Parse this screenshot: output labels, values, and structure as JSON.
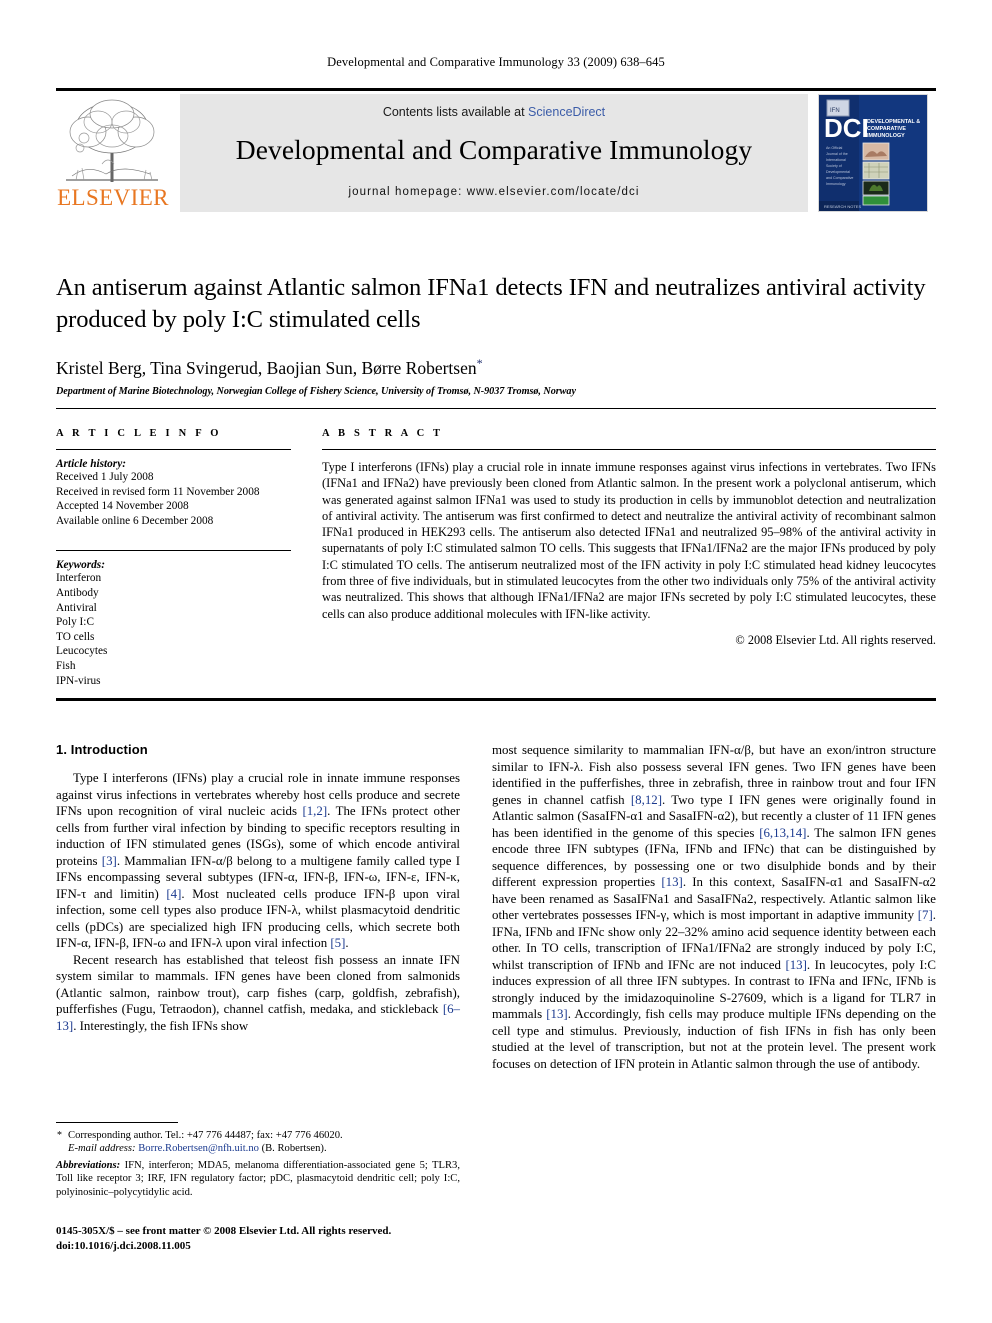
{
  "running_head": "Developmental and Comparative Immunology 33 (2009) 638–645",
  "masthead": {
    "contents_prefix": "Contents lists available at ",
    "sciencedirect": "ScienceDirect",
    "journal_name": "Developmental and Comparative Immunology",
    "homepage": "journal homepage: www.elsevier.com/locate/dci",
    "elsevier_wordmark": "ELSEVIER",
    "cover_brand": "DCI",
    "cover_title_line1": "DEVELOPMENTAL &",
    "cover_title_line2": "COMPARATIVE",
    "cover_title_line3": "IMMUNOLOGY",
    "link_color": "#3b5ca8",
    "elsevier_orange": "#E87722",
    "cover_blue": "#0d2f73"
  },
  "title": "An antiserum against Atlantic salmon IFNa1 detects IFN and neutralizes antiviral activity produced by poly I:C stimulated cells",
  "authors": "Kristel Berg, Tina Svingerud, Baojian Sun, Børre Robertsen",
  "author_star": "*",
  "affiliation": "Department of Marine Biotechnology, Norwegian College of Fishery Science, University of Tromsø, N-9037 Tromsø, Norway",
  "article_info": {
    "heading": "A R T I C L E   I N F O",
    "history_label": "Article history:",
    "history": [
      "Received 1 July 2008",
      "Received in revised form 11 November 2008",
      "Accepted 14 November 2008",
      "Available online 6 December 2008"
    ],
    "keywords_label": "Keywords:",
    "keywords": [
      "Interferon",
      "Antibody",
      "Antiviral",
      "Poly I:C",
      "TO cells",
      "Leucocytes",
      "Fish",
      "IPN-virus"
    ]
  },
  "abstract": {
    "heading": "A B S T R A C T",
    "text": "Type I interferons (IFNs) play a crucial role in innate immune responses against virus infections in vertebrates. Two IFNs (IFNa1 and IFNa2) have previously been cloned from Atlantic salmon. In the present work a polyclonal antiserum, which was generated against salmon IFNa1 was used to study its production in cells by immunoblot detection and neutralization of antiviral activity. The antiserum was first confirmed to detect and neutralize the antiviral activity of recombinant salmon IFNa1 produced in HEK293 cells. The antiserum also detected IFNa1 and neutralized 95–98% of the antiviral activity in supernatants of poly I:C stimulated salmon TO cells. This suggests that IFNa1/IFNa2 are the major IFNs produced by poly I:C stimulated TO cells. The antiserum neutralized most of the IFN activity in poly I:C stimulated head kidney leucocytes from three of five individuals, but in stimulated leucocytes from the other two individuals only 75% of the antiviral activity was neutralized. This shows that although IFNa1/IFNa2 are major IFNs secreted by poly I:C stimulated leucocytes, these cells can also produce additional molecules with IFN-like activity.",
    "copyright": "© 2008 Elsevier Ltd. All rights reserved."
  },
  "introduction": {
    "heading": "1. Introduction",
    "left_paragraphs": [
      "Type I interferons (IFNs) play a crucial role in innate immune responses against virus infections in vertebrates whereby host cells produce and secrete IFNs upon recognition of viral nucleic acids [1,2]. The IFNs protect other cells from further viral infection by binding to specific receptors resulting in induction of IFN stimulated genes (ISGs), some of which encode antiviral proteins [3]. Mammalian IFN-α/β belong to a multigene family called type I IFNs encompassing several subtypes (IFN-α, IFN-β, IFN-ω, IFN-ε, IFN-κ, IFN-τ and limitin) [4]. Most nucleated cells produce IFN-β upon viral infection, some cell types also produce IFN-λ, whilst plasmacytoid dendritic cells (pDCs) are specialized high IFN producing cells, which secrete both IFN-α, IFN-β, IFN-ω and IFN-λ upon viral infection [5].",
      "Recent research has established that teleost fish possess an innate IFN system similar to mammals. IFN genes have been cloned from salmonids (Atlantic salmon, rainbow trout), carp fishes (carp, goldfish, zebrafish), pufferfishes (Fugu, Tetraodon), channel catfish, medaka, and stickleback [6–13]. Interestingly, the fish IFNs show"
    ],
    "right_paragraphs": [
      "most sequence similarity to mammalian IFN-α/β, but have an exon/intron structure similar to IFN-λ. Fish also possess several IFN genes. Two IFN genes have been identified in the pufferfishes, three in zebrafish, three in rainbow trout and four IFN genes in channel catfish [8,12]. Two type I IFN genes were originally found in Atlantic salmon (SasaIFN-α1 and SasaIFN-α2), but recently a cluster of 11 IFN genes has been identified in the genome of this species [6,13,14]. The salmon IFN genes encode three IFN subtypes (IFNa, IFNb and IFNc) that can be distinguished by sequence differences, by possessing one or two disulphide bonds and by their different expression properties [13]. In this context, SasaIFN-α1 and SasaIFN-α2 have been renamed as SasaIFNa1 and SasaIFNa2, respectively. Atlantic salmon like other vertebrates possesses IFN-γ, which is most important in adaptive immunity [7]. IFNa, IFNb and IFNc show only 22–32% amino acid sequence identity between each other. In TO cells, transcription of IFNa1/IFNa2 are strongly induced by poly I:C, whilst transcription of IFNb and IFNc are not induced [13]. In leucocytes, poly I:C induces expression of all three IFN subtypes. In contrast to IFNa and IFNc, IFNb is strongly induced by the imidazoquinoline S-27609, which is a ligand for TLR7 in mammals [13]. Accordingly, fish cells may produce multiple IFNs depending on the cell type and stimulus. Previously, induction of fish IFNs in fish has only been studied at the level of transcription, but not at the protein level. The present work focuses on detection of IFN protein in Atlantic salmon through the use of antibody."
    ]
  },
  "footnote": {
    "corresponding": "Corresponding author. Tel.: +47 776 44487; fax: +47 776 46020.",
    "email_label": "E-mail address:",
    "email": "Borre.Robertsen@nfh.uit.no",
    "email_suffix": "(B. Robertsen).",
    "abbrev_label": "Abbreviations:",
    "abbrev_text": "IFN, interferon; MDA5, melanoma differentiation-associated gene 5; TLR3, Toll like receptor 3; IRF, IFN regulatory factor; pDC, plasmacytoid dendritic cell; poly I:C, polyinosinic–polycytidylic acid.",
    "front_matter": "0145-305X/$ – see front matter © 2008 Elsevier Ltd. All rights reserved.",
    "doi": "doi:10.1016/j.dci.2008.11.005"
  }
}
